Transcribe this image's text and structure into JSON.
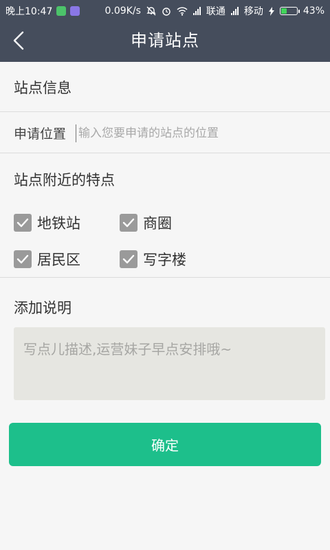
{
  "status_bar": {
    "time": "晚上10:47",
    "speed": "0.09K/s",
    "carrier1": "联通",
    "carrier2": "移动",
    "battery": "43%",
    "battery_level": 0.43
  },
  "nav": {
    "title": "申请站点"
  },
  "site_info": {
    "title": "站点信息"
  },
  "location": {
    "label": "申请位置",
    "placeholder": "输入您要申请的站点的位置",
    "value": ""
  },
  "features": {
    "title": "站点附近的特点",
    "items": [
      {
        "label": "地铁站",
        "checked": true
      },
      {
        "label": "商圈",
        "checked": true
      },
      {
        "label": "居民区",
        "checked": true
      },
      {
        "label": "写字楼",
        "checked": true
      }
    ]
  },
  "notes": {
    "title": "添加说明",
    "placeholder": "写点儿描述,运营妹子早点安排哦~",
    "value": ""
  },
  "confirm_label": "确定",
  "colors": {
    "header": "#454d5c",
    "accent": "#1dbf8b",
    "checkbox": "#9a9a9a"
  }
}
